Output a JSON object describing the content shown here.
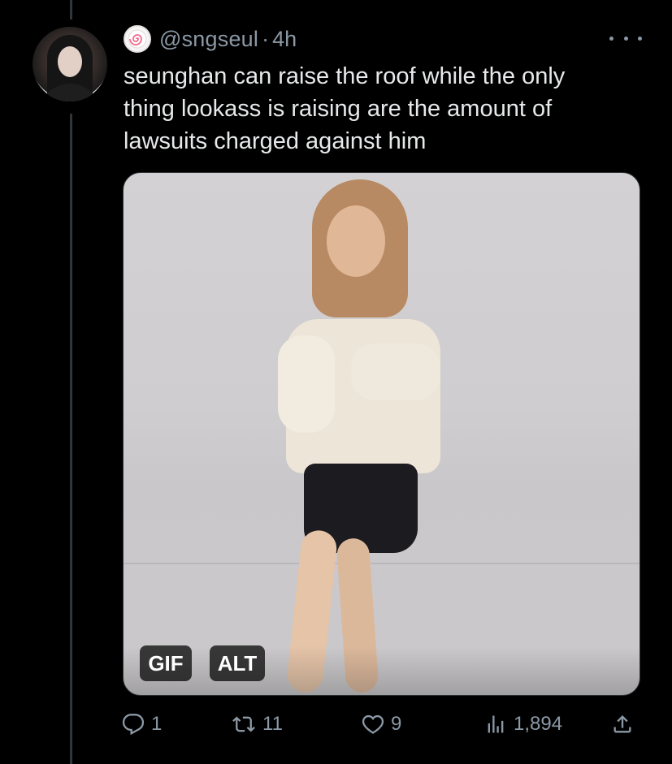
{
  "tweet": {
    "handle": "@sngseul",
    "separator": "·",
    "time": "4h",
    "text": "seunghan can raise the roof while the only\nthing lookass is raising are the amount of\nlawsuits charged against him"
  },
  "media": {
    "gif_label": "GIF",
    "alt_label": "ALT"
  },
  "actions": {
    "replies": "1",
    "retweets": "11",
    "likes": "9",
    "views": "1,894"
  },
  "colors": {
    "background": "#000000",
    "text": "#e7e9ea",
    "secondary_text": "#8b98a5",
    "thread_line": "#333639"
  },
  "icons": {
    "avatar": "profile-photo",
    "badge": "fishcake-emoji-icon",
    "more": "more-dots-icon",
    "reply": "reply-icon",
    "retweet": "retweet-icon",
    "like": "heart-icon",
    "views": "views-chart-icon",
    "share": "share-icon"
  }
}
